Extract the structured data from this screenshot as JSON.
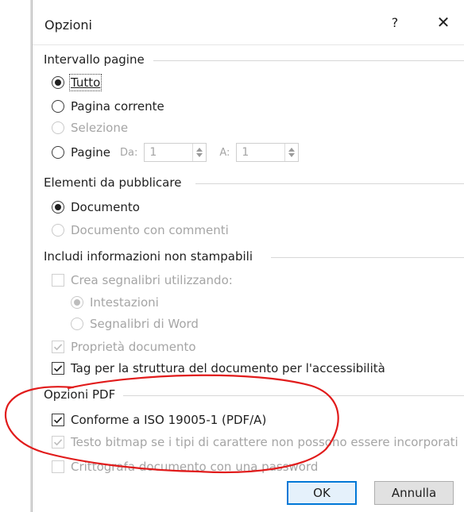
{
  "dialog": {
    "title": "Opzioni",
    "help_glyph": "?",
    "close_glyph": "✕"
  },
  "page_range": {
    "group_title": "Intervallo pagine",
    "all_label": "Tutto",
    "current_page_label": "Pagina corrente",
    "selection_label": "Selezione",
    "pages_label": "Pagine",
    "from_label": "Da:",
    "from_value": "1",
    "to_label": "A:",
    "to_value": "1"
  },
  "publish_elements": {
    "group_title": "Elementi da pubblicare",
    "document_label": "Documento",
    "document_with_comments_label": "Documento con commenti"
  },
  "non_printing_info": {
    "group_title": "Includi informazioni non stampabili",
    "create_bookmarks_label": "Crea segnalibri utilizzando:",
    "headings_label": "Intestazioni",
    "word_bookmarks_label": "Segnalibri di Word",
    "document_properties_label": "Proprietà documento",
    "accessibility_tags_label": "Tag per la struttura del documento per l'accessibilità"
  },
  "pdf_options": {
    "group_title": "Opzioni PDF",
    "iso_compliant_label": "Conforme a ISO 19005-1 (PDF/A)",
    "bitmap_text_label": "Testo bitmap se i tipi di carattere non possono essere incorporati",
    "encrypt_label": "Crittografa documento con una password"
  },
  "footer": {
    "ok_label": "OK",
    "cancel_label": "Annulla"
  },
  "colors": {
    "annotation_red": "#e11b1b",
    "primary_blue": "#0078d7",
    "disabled_text": "#a5a5a5"
  }
}
